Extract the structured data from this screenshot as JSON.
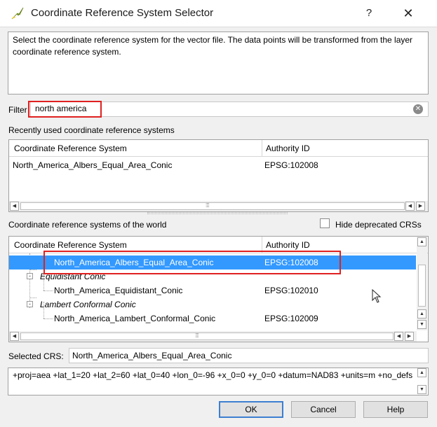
{
  "window": {
    "title": "Coordinate Reference System Selector",
    "help_label": "?",
    "close_label": "✕",
    "icon": "qgis-icon"
  },
  "description": "Select the coordinate reference system for the vector file. The data points will be transformed from the layer coordinate reference system.",
  "filter": {
    "label": "Filter",
    "value": "north america",
    "clear_icon": "clear-icon"
  },
  "recent": {
    "label": "Recently used coordinate reference systems",
    "columns": [
      "Coordinate Reference System",
      "Authority ID"
    ],
    "rows": [
      {
        "name": "North_America_Albers_Equal_Area_Conic",
        "id": "EPSG:102008"
      }
    ]
  },
  "world": {
    "label": "Coordinate reference systems of the world",
    "hide_deprecated_label": "Hide deprecated CRSs",
    "hide_deprecated_checked": false,
    "columns": [
      "Coordinate Reference System",
      "Authority ID"
    ],
    "rows": [
      {
        "name": "North_America_Albers_Equal_Area_Conic",
        "id": "EPSG:102008",
        "selected": true
      },
      {
        "group": "Equidistant Conic"
      },
      {
        "name": "North_America_Equidistant_Conic",
        "id": "EPSG:102010"
      },
      {
        "group": "Lambert Conformal Conic"
      },
      {
        "name": "North_America_Lambert_Conformal_Conic",
        "id": "EPSG:102009"
      }
    ]
  },
  "selected_crs": {
    "label": "Selected CRS:",
    "value": "North_America_Albers_Equal_Area_Conic"
  },
  "proj_string": "+proj=aea +lat_1=20 +lat_2=60 +lat_0=40 +lon_0=-96 +x_0=0 +y_0=0 +datum=NAD83 +units=m +no_defs",
  "buttons": {
    "ok": "OK",
    "cancel": "Cancel",
    "help": "Help"
  },
  "colors": {
    "selection": "#3399ff",
    "highlight_box": "#e02020",
    "default_button_border": "#3c7fd0"
  }
}
